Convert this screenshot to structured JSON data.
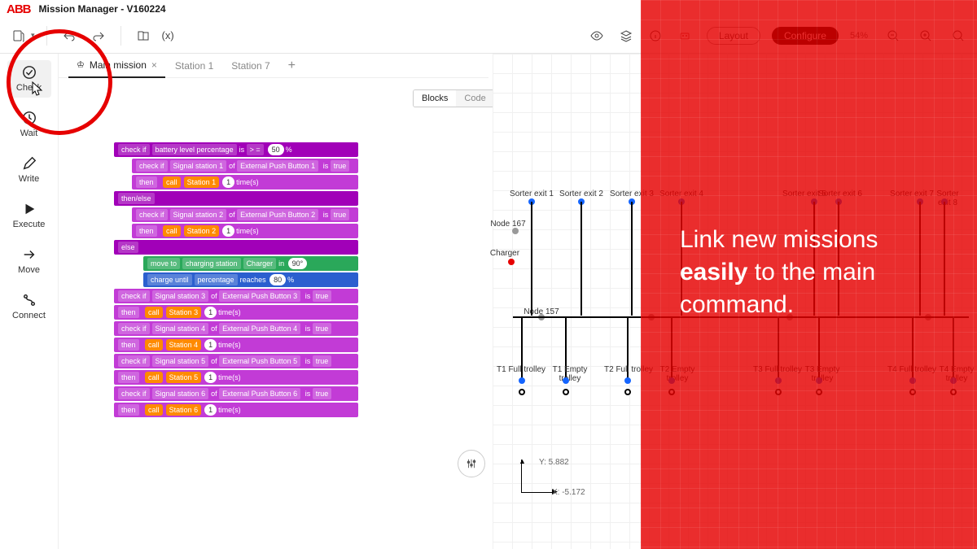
{
  "title": {
    "logo": "ABB",
    "text": "Mission Manager - V160224"
  },
  "topbar": {
    "xvar": "(x)",
    "layout_btn": "Layout",
    "configure_btn": "Configure",
    "zoom_pct": "54%"
  },
  "left_tools": [
    {
      "key": "check",
      "label": "Check",
      "selected": true
    },
    {
      "key": "wait",
      "label": "Wait"
    },
    {
      "key": "write",
      "label": "Write"
    },
    {
      "key": "execute",
      "label": "Execute"
    },
    {
      "key": "move",
      "label": "Move"
    },
    {
      "key": "connect",
      "label": "Connect"
    }
  ],
  "tabs": [
    {
      "label": "Main mission",
      "active": true,
      "close": "×"
    },
    {
      "label": "Station 1"
    },
    {
      "label": "Station 7"
    }
  ],
  "view_toggle": {
    "blocks": "Blocks",
    "code": "Code",
    "active": "blocks"
  },
  "overlay": {
    "line1_a": "Link new missions",
    "line2_a": "easily",
    "line2_b": " to the main",
    "line3": "command."
  },
  "map": {
    "top_labels": [
      "Sorter exit 1",
      "Sorter exit 2",
      "Sorter exit 3",
      "Sorter exit 4",
      "Sorter exit 5",
      "Sorter exit 6",
      "Sorter exit 7",
      "Sorter exit 8"
    ],
    "left_label_1": "Node 167",
    "left_label_2": "Charger",
    "mid_label": "Node 157",
    "bottom_labels": [
      "T1 Full trolley",
      "T1 Empty trolley",
      "T2 Full trolley",
      "T2 Empty trolley",
      "T3 Full trolley",
      "T3 Empty trolley",
      "T4 Full trolley",
      "T4 Empty trolley"
    ],
    "coord_y": "Y: 5.882",
    "coord_x": "X: -5.172"
  },
  "blocks": {
    "check_if": "check if",
    "battery": "battery level percentage",
    "is": "is",
    "ge": "> =",
    "pct50": "50",
    "pct": "%",
    "signal": "Signal station",
    "of": "of",
    "ext_btn": "External Push Button",
    "true": "true",
    "then": "then",
    "then_else": "then/else",
    "else": "else",
    "call": "call",
    "station": "Station",
    "one": "1",
    "times": "time(s)",
    "move_to": "move to",
    "charging_station": "charging station",
    "charger": "Charger",
    "in": "in",
    "deg90": "90°",
    "charge_until": "charge until",
    "percentage": "percentage",
    "reaches": "reaches",
    "v80": "80"
  }
}
